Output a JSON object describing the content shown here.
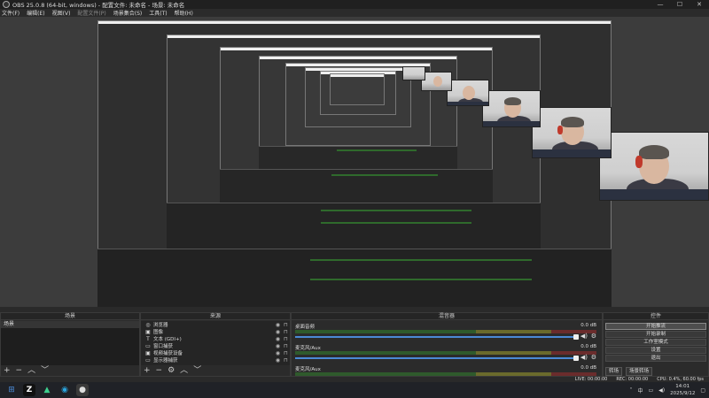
{
  "window": {
    "title": "OBS 25.0.8 (64-bit, windows) - 配置文件: 未命名 - 场景: 未命名",
    "minimize": "—",
    "maximize": "☐",
    "close": "✕"
  },
  "menu": [
    "文件(F)",
    "编辑(E)",
    "视图(V)",
    "配置文件(P)",
    "场景集合(S)",
    "工具(T)",
    "帮助(H)"
  ],
  "docks": {
    "scenes": {
      "title": "场景",
      "items": [
        "场景"
      ]
    },
    "sources": {
      "title": "来源",
      "items": [
        {
          "icon": "browser-icon",
          "glyph": "◎",
          "name": "浏览器"
        },
        {
          "icon": "image-icon",
          "glyph": "▣",
          "name": "图像"
        },
        {
          "icon": "text-icon",
          "glyph": "T",
          "name": "文本 (GDI+)"
        },
        {
          "icon": "window-capture-icon",
          "glyph": "▭",
          "name": "窗口捕获"
        },
        {
          "icon": "video-capture-icon",
          "glyph": "▣",
          "name": "视频捕获设备"
        },
        {
          "icon": "display-capture-icon",
          "glyph": "▭",
          "name": "显示器捕获"
        }
      ]
    },
    "mixer": {
      "title": "混音器",
      "items": [
        {
          "name": "桌面音频",
          "db": "0.0 dB"
        },
        {
          "name": "麦克风/Aux",
          "db": "0.0 dB"
        },
        {
          "name": "麦克风/Aux",
          "db": "0.0 dB"
        }
      ],
      "tick_labels": [
        "-60",
        "-55",
        "-50",
        "-45",
        "-40",
        "-35",
        "-30",
        "-25",
        "-20",
        "-15",
        "-10",
        "-5",
        "0"
      ]
    },
    "controls": {
      "title": "控件",
      "buttons": [
        "开始推流",
        "开始录制",
        "工作室模式",
        "设置",
        "退出"
      ]
    },
    "tabs": [
      "转场",
      "场景转场"
    ]
  },
  "statusbar": {
    "live": "LIVE: 00:00:00",
    "rec": "REC: 00:00:00",
    "cpu": "CPU: 0.4%, 60.00 fps"
  },
  "taskbar": {
    "time": "14:01",
    "date": "2025/9/12",
    "lang": "中"
  },
  "colors": {
    "accent": "#4a8ad6",
    "titlebar": "#202020",
    "dock": "#2b2b2b"
  }
}
